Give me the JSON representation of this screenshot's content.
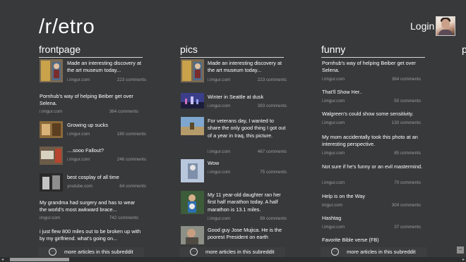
{
  "app": {
    "title": "/r/etro",
    "login_label": "Login"
  },
  "columns": [
    {
      "header": "frontpage",
      "items": [
        {
          "title": "Made an interesting discovery at the art museum today...",
          "source": "i.imgur.com",
          "comments": "223 comments",
          "thumb": "museum-thumbnail"
        },
        {
          "title": "Pornhub's way of helping Beiber get over Selena.",
          "source": "i.imgur.com",
          "comments": "364 comments"
        },
        {
          "title": "Growing up sucks",
          "source": "i.imgur.com",
          "comments": "180 comments",
          "thumb": "growing-up-thumbnail"
        },
        {
          "title": "....sooo Fallout?",
          "source": "i.imgur.com",
          "comments": "246 comments",
          "thumb": "fallout-thumbnail"
        },
        {
          "title": "best cosplay of all time",
          "source": "youtube.com",
          "comments": "64 comments",
          "thumb": "cosplay-thumbnail"
        },
        {
          "title": "My grandma had surgery and has to wear the world's most awkward brace...",
          "source": "imgur.com",
          "comments": "742 comments"
        },
        {
          "title": "i just flew 800 miles out to be broken up with by my girlfriend. what's going on..."
        }
      ],
      "more_label": "more articles in this subreddit"
    },
    {
      "header": "pics",
      "items": [
        {
          "title": "Made an interesting discovery at the art museum today...",
          "source": "i.imgur.com",
          "comments": "223 comments",
          "thumb": "museum-thumbnail"
        },
        {
          "title": "Winter in Seattle at dusk",
          "source": "i.imgur.com",
          "comments": "393 comments",
          "thumb": "seattle-thumbnail"
        },
        {
          "title": "For veterans day, I wanted to share the only good thing I got out of a year in Iraq, this picture.",
          "source": "i.imgur.com",
          "comments": "467 comments",
          "thumb": "iraq-thumbnail"
        },
        {
          "title": "Wow",
          "source": "i.imgur.com",
          "comments": "75 comments",
          "thumb": "wow-thumbnail"
        },
        {
          "title": "My 11 year-old daughter ran her first half marathon today. A half marathon is 13.1 miles.",
          "source": "i.imgur.com",
          "comments": "89 comments",
          "thumb": "marathon-thumbnail"
        },
        {
          "title": "Good guy Jose Mujica. He is the poorest President on earth",
          "thumb": "mujica-thumbnail"
        }
      ],
      "more_label": "more articles in this subreddit"
    },
    {
      "header": "funny",
      "items": [
        {
          "title": "Pornhub's way of helping Beiber get over Selena.",
          "source": "i.imgur.com",
          "comments": "364 comments"
        },
        {
          "title": "That'll Show Her..",
          "source": "i.imgur.com",
          "comments": "50 comments"
        },
        {
          "title": "Walgreen's could show some sensitivity.",
          "source": "i.imgur.com",
          "comments": "130 comments"
        },
        {
          "title": "My mom accidentally took this photo at an interesting perspective.",
          "source": "i.imgur.com",
          "comments": "85 comments"
        },
        {
          "title": "Not sure if he's funny or an evil mastermind.",
          "source": "i.imgur.com",
          "comments": "70 comments"
        },
        {
          "title": "Help is on the Way",
          "source": "imgur.com",
          "comments": "304 comments"
        },
        {
          "title": "Hashtag",
          "source": "i.imgur.com",
          "comments": "37 comments"
        },
        {
          "title": "Favorite Bible verse (FB)"
        }
      ],
      "more_label": "more articles in this subreddit"
    },
    {
      "header": "p",
      "items": [
        {
          "title": "If"
        },
        {
          "title": "s"
        },
        {
          "title": "U"
        },
        {
          "title": "i."
        },
        {
          "title": "\"I"
        },
        {
          "title": "ra"
        },
        {
          "title": "W"
        },
        {
          "title": "i."
        }
      ]
    }
  ],
  "colors": {
    "background": "#38393b",
    "divider": "#d6d6d6",
    "meta_text": "#9c9c9c",
    "scrollbar_thumb": "#9b9b9b"
  },
  "icons": {
    "more": "ellipsis-circle-icon",
    "zoom": "semantic-zoom-minus-icon"
  },
  "zoom_label": "−",
  "more_icon_glyph": "···"
}
